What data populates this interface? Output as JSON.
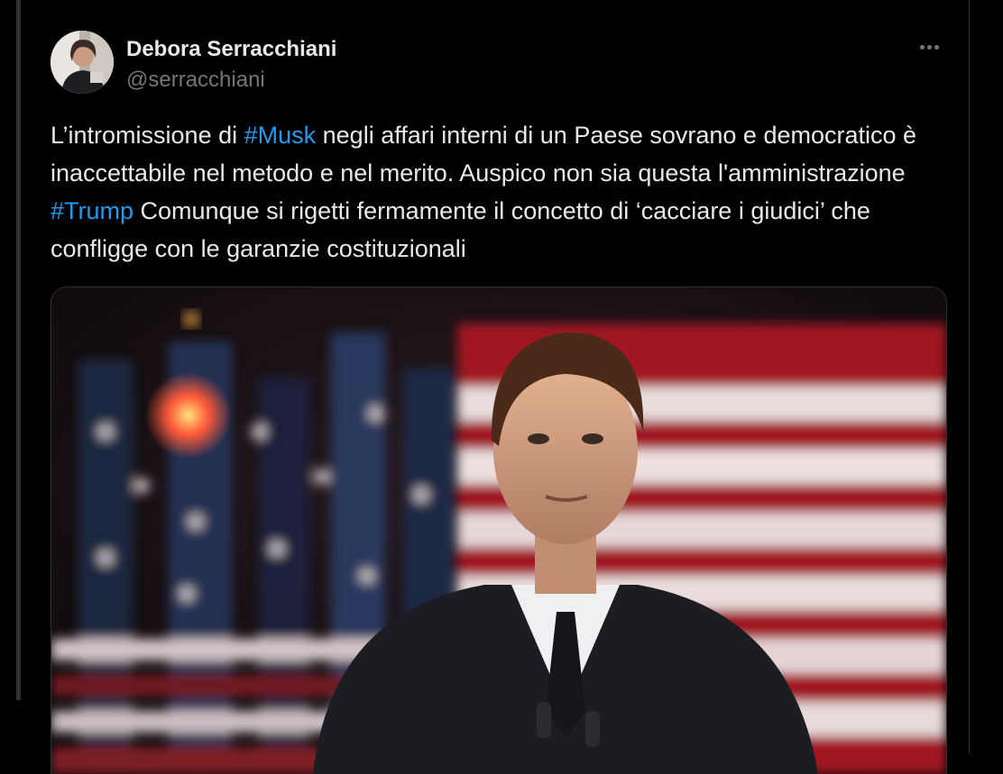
{
  "author": {
    "display_name": "Debora Serracchiani",
    "handle": "@serracchiani"
  },
  "icons": {
    "more": "more-horizontal-icon"
  },
  "tweet": {
    "parts": [
      "L’intromissione di ",
      "#Musk",
      " negli affari interni di un Paese sovrano e democratico è inaccettabile nel metodo e nel merito. Auspico non sia questa l'amministrazione ",
      "#Trump",
      " Comunque si rigetti fermamente il concetto di ‘cacciare i giudici’ che confligge con le garanzie costituzionali"
    ]
  },
  "colors": {
    "background": "#000000",
    "text": "#e7e9ea",
    "secondary": "#71767b",
    "link": "#1d9bf0",
    "border": "#2f3336"
  }
}
